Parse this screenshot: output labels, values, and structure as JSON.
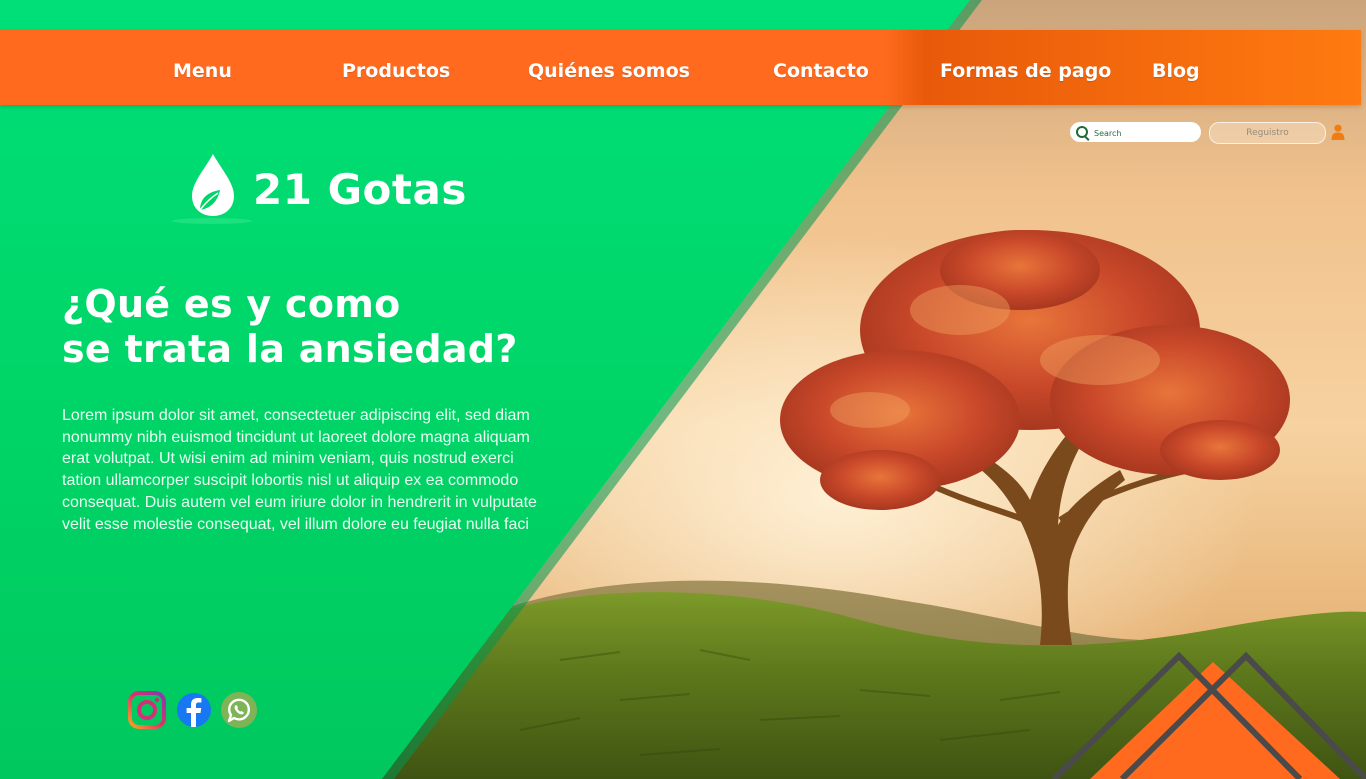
{
  "nav": {
    "items": [
      {
        "label": "Menu"
      },
      {
        "label": "Productos"
      },
      {
        "label": "Quiénes somos"
      },
      {
        "label": "Contacto"
      },
      {
        "label": "Formas de pago"
      },
      {
        "label": "Blog"
      }
    ]
  },
  "search": {
    "placeholder": "Search"
  },
  "account": {
    "register_label": "Reguistro",
    "user_icon": "user-icon"
  },
  "brand": {
    "name": "21 Gotas",
    "logo_icon": "water-drop-leaf-icon"
  },
  "hero": {
    "title_line1": "¿Qué es y como",
    "title_line2": "se trata la ansiedad?",
    "body": "Lorem ipsum dolor sit amet, consectetuer adipiscing elit, sed diam nonummy nibh euismod tincidunt ut laoreet dolore magna aliquam erat volutpat. Ut wisi enim ad minim veniam, quis nostrud exerci tation ullamcorper suscipit lobortis nisl ut aliquip ex ea commodo consequat. Duis autem vel eum iriure dolor in hendrerit in vulputate velit esse molestie consequat, vel illum dolore eu feugiat nulla faci"
  },
  "social": [
    {
      "name": "instagram-icon"
    },
    {
      "name": "facebook-icon"
    },
    {
      "name": "whatsapp-icon"
    }
  ],
  "colors": {
    "green": "#00d56a",
    "orange": "#ff6a1e",
    "sky": "#f3c58e",
    "hill": "#6e8a1e",
    "tree_foliage": "#d2552a"
  }
}
